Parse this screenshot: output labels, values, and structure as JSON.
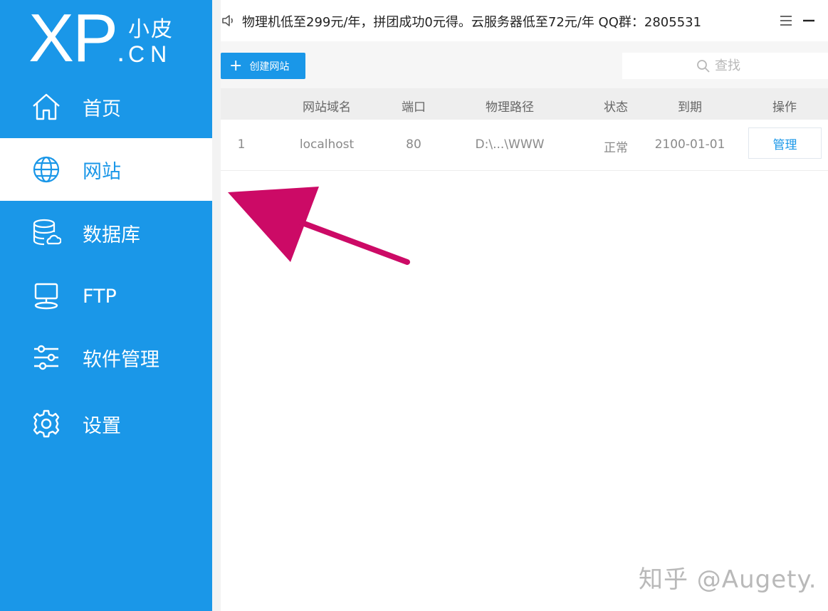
{
  "logo": {
    "main": "XP",
    "dot": ".",
    "cn_top": "小皮",
    "cn_bottom": "CN"
  },
  "sidebar": {
    "items": [
      {
        "label": "首页",
        "icon": "home-icon",
        "active": false
      },
      {
        "label": "网站",
        "icon": "globe-icon",
        "active": true
      },
      {
        "label": "数据库",
        "icon": "database-icon",
        "active": false
      },
      {
        "label": "FTP",
        "icon": "ftp-icon",
        "active": false
      },
      {
        "label": "软件管理",
        "icon": "sliders-icon",
        "active": false
      },
      {
        "label": "设置",
        "icon": "gear-icon",
        "active": false
      }
    ]
  },
  "topbar": {
    "notice": "物理机低至299元/年，拼团成功0元得。云服务器低至72元/年 QQ群：2805531",
    "icons": [
      "speaker-icon",
      "menu-icon",
      "minimize-icon"
    ]
  },
  "toolbar": {
    "create_label": "创建网站",
    "search_placeholder": "查找"
  },
  "table": {
    "columns": [
      "网站域名",
      "端口",
      "物理路径",
      "状态",
      "到期",
      "操作"
    ],
    "rows": [
      {
        "index": "1",
        "domain": "localhost",
        "port": "80",
        "path": "D:\\...\\WWW",
        "status": "正常",
        "expire": "2100-01-01",
        "action": "管理"
      }
    ]
  },
  "watermark": "知乎 @Augety.",
  "colors": {
    "accent": "#1a97e8",
    "annotation_arrow": "#cc0a66"
  }
}
